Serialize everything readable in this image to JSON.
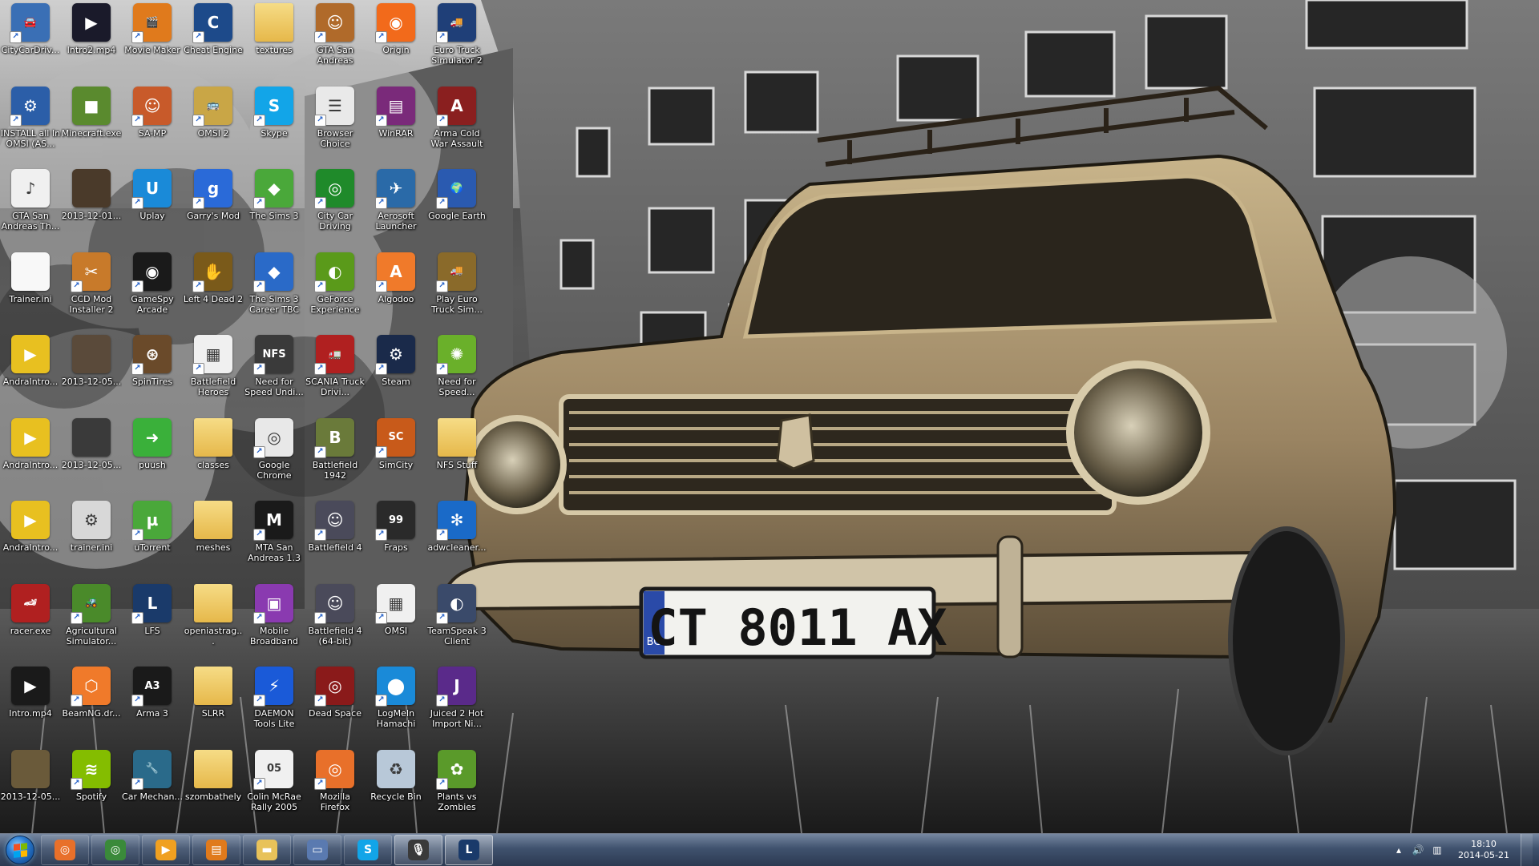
{
  "screen": {
    "name": "Windows 7 desktop"
  },
  "wallpaper": {
    "plate_country": "BG",
    "plate_text": "CT 8011 AX"
  },
  "desktop_icons": [
    {
      "label": "CityCarDriv...",
      "icon": "city-car-driving-icon",
      "color": "#3a6fb5",
      "glyph": "🚘",
      "shortcut": true
    },
    {
      "label": "Intro2.mp4",
      "icon": "video-file-icon",
      "color": "#1a1a2a",
      "glyph": "▶",
      "shortcut": false
    },
    {
      "label": "Movie Maker",
      "icon": "movie-maker-icon",
      "color": "#e07a1c",
      "glyph": "🎬",
      "shortcut": true
    },
    {
      "label": "Cheat Engine",
      "icon": "cheat-engine-icon",
      "color": "#1d4a8a",
      "glyph": "C",
      "shortcut": true
    },
    {
      "label": "textures",
      "icon": "folder-icon",
      "color": "#e8c25a",
      "glyph": "",
      "shortcut": false,
      "folder": true
    },
    {
      "label": "GTA San Andreas",
      "icon": "gta-san-andreas-icon",
      "color": "#b06a2a",
      "glyph": "☺",
      "shortcut": true
    },
    {
      "label": "Origin",
      "icon": "origin-icon",
      "color": "#f26a1b",
      "glyph": "◉",
      "shortcut": true
    },
    {
      "label": "Euro Truck Simulator 2",
      "icon": "euro-truck-simulator-icon",
      "color": "#1f3f78",
      "glyph": "🚚",
      "shortcut": true
    },
    {
      "label": "INSTALL all In OMSI (AS...",
      "icon": "installer-icon",
      "color": "#2b5ea8",
      "glyph": "⚙",
      "shortcut": true
    },
    {
      "label": "Minecraft.exe",
      "icon": "minecraft-icon",
      "color": "#5a8a2e",
      "glyph": "■",
      "shortcut": false
    },
    {
      "label": "SA-MP",
      "icon": "sa-mp-icon",
      "color": "#c85a2a",
      "glyph": "☺",
      "shortcut": true
    },
    {
      "label": "OMSI 2",
      "icon": "omsi-2-icon",
      "color": "#c9a646",
      "glyph": "🚌",
      "shortcut": true
    },
    {
      "label": "Skype",
      "icon": "skype-icon",
      "color": "#12a5e8",
      "glyph": "S",
      "shortcut": true
    },
    {
      "label": "Browser Choice",
      "icon": "browser-choice-icon",
      "color": "#e9e9e9",
      "glyph": "☰",
      "shortcut": true
    },
    {
      "label": "WinRAR",
      "icon": "winrar-icon",
      "color": "#7a2a7a",
      "glyph": "▤",
      "shortcut": true
    },
    {
      "label": "Arma Cold War Assault",
      "icon": "arma-cold-war-icon",
      "color": "#8a1f1f",
      "glyph": "A",
      "shortcut": true
    },
    {
      "label": "GTA San Andreas Th...",
      "icon": "mp3-file-icon",
      "color": "#f0f0f0",
      "glyph": "♪",
      "shortcut": false
    },
    {
      "label": "2013-12-01...",
      "icon": "video-thumbnail-icon",
      "color": "#4a3a2a",
      "glyph": "",
      "shortcut": false
    },
    {
      "label": "Uplay",
      "icon": "uplay-icon",
      "color": "#1a8ad8",
      "glyph": "U",
      "shortcut": true
    },
    {
      "label": "Garry's Mod",
      "icon": "garrys-mod-icon",
      "color": "#2a6ad8",
      "glyph": "g",
      "shortcut": true
    },
    {
      "label": "The Sims 3",
      "icon": "the-sims-icon",
      "color": "#4aa83a",
      "glyph": "◆",
      "shortcut": true
    },
    {
      "label": "City Car Driving",
      "icon": "city-car-driving-2-icon",
      "color": "#1f8a2a",
      "glyph": "◎",
      "shortcut": true
    },
    {
      "label": "Aerosoft Launcher",
      "icon": "aerosoft-icon",
      "color": "#2a6aa8",
      "glyph": "✈",
      "shortcut": true
    },
    {
      "label": "Google Earth",
      "icon": "google-earth-icon",
      "color": "#2a5ab0",
      "glyph": "🌍",
      "shortcut": true
    },
    {
      "label": "Trainer.ini",
      "icon": "text-file-icon",
      "color": "#f8f8f8",
      "glyph": "",
      "shortcut": false
    },
    {
      "label": "CCD Mod Installer 2",
      "icon": "ccd-mod-installer-icon",
      "color": "#c87a2a",
      "glyph": "✂",
      "shortcut": true
    },
    {
      "label": "GameSpy Arcade",
      "icon": "gamespy-icon",
      "color": "#1a1a1a",
      "glyph": "◉",
      "shortcut": true
    },
    {
      "label": "Left 4 Dead 2",
      "icon": "left-4-dead-2-icon",
      "color": "#7a5a1a",
      "glyph": "✋",
      "shortcut": true
    },
    {
      "label": "The Sims 3 Career TBC",
      "icon": "the-sims-career-icon",
      "color": "#2a6ac8",
      "glyph": "◆",
      "shortcut": true
    },
    {
      "label": "GeForce Experience",
      "icon": "geforce-icon",
      "color": "#5a9a1a",
      "glyph": "◐",
      "shortcut": true
    },
    {
      "label": "Algodoo",
      "icon": "algodoo-icon",
      "color": "#f07a2a",
      "glyph": "A",
      "shortcut": true
    },
    {
      "label": "Play Euro Truck Sim...",
      "icon": "play-euro-truck-icon",
      "color": "#8a6a2a",
      "glyph": "🚚",
      "shortcut": true
    },
    {
      "label": "AndraIntro...",
      "icon": "video-file-yellow-icon",
      "color": "#e8c020",
      "glyph": "▶",
      "shortcut": false
    },
    {
      "label": "2013-12-05...",
      "icon": "video-thumbnail-2-icon",
      "color": "#5a4a3a",
      "glyph": "",
      "shortcut": false
    },
    {
      "label": "SpinTires",
      "icon": "spintires-icon",
      "color": "#6a4a2a",
      "glyph": "⊛",
      "shortcut": true
    },
    {
      "label": "Battlefield Heroes",
      "icon": "calendar-icon",
      "color": "#f0f0f0",
      "glyph": "▦",
      "shortcut": true
    },
    {
      "label": "Need for Speed Undi...",
      "icon": "need-for-speed-icon",
      "color": "#3a3a3a",
      "glyph": "NFS",
      "shortcut": true
    },
    {
      "label": "SCANIA Truck Drivi...",
      "icon": "scania-icon",
      "color": "#b02020",
      "glyph": "🚛",
      "shortcut": true
    },
    {
      "label": "Steam",
      "icon": "steam-icon",
      "color": "#1a2a4a",
      "glyph": "⚙",
      "shortcut": true
    },
    {
      "label": "Need for Speed...",
      "icon": "need-for-speed-2-icon",
      "color": "#6ab02a",
      "glyph": "✺",
      "shortcut": true
    },
    {
      "label": "AndraIntro...",
      "icon": "video-file-yellow-2-icon",
      "color": "#e8c020",
      "glyph": "▶",
      "shortcut": false
    },
    {
      "label": "2013-12-05...",
      "icon": "video-thumbnail-3-icon",
      "color": "#3a3a3a",
      "glyph": "",
      "shortcut": false
    },
    {
      "label": "puush",
      "icon": "puush-icon",
      "color": "#3ab03a",
      "glyph": "➜",
      "shortcut": false
    },
    {
      "label": "classes",
      "icon": "folder-icon",
      "color": "#e8c25a",
      "glyph": "",
      "shortcut": false,
      "folder": true
    },
    {
      "label": "Google Chrome",
      "icon": "chrome-icon",
      "color": "#e8e8e8",
      "glyph": "◎",
      "shortcut": true
    },
    {
      "label": "Battlefield 1942",
      "icon": "battlefield-1942-icon",
      "color": "#6a7a3a",
      "glyph": "B",
      "shortcut": true
    },
    {
      "label": "SimCity",
      "icon": "simcity-icon",
      "color": "#c85a1a",
      "glyph": "SC",
      "shortcut": true
    },
    {
      "label": "NFS Stuff",
      "icon": "folder-icon",
      "color": "#e8c25a",
      "glyph": "",
      "shortcut": false,
      "folder": true
    },
    {
      "label": "AndraIntro...",
      "icon": "video-file-yellow-3-icon",
      "color": "#e8c020",
      "glyph": "▶",
      "shortcut": false
    },
    {
      "label": "trainer.ini",
      "icon": "settings-file-icon",
      "color": "#d8d8d8",
      "glyph": "⚙",
      "shortcut": false
    },
    {
      "label": "uTorrent",
      "icon": "utorrent-icon",
      "color": "#4aa83a",
      "glyph": "µ",
      "shortcut": true
    },
    {
      "label": "meshes",
      "icon": "folder-icon",
      "color": "#e8c25a",
      "glyph": "",
      "shortcut": false,
      "folder": true
    },
    {
      "label": "MTA San Andreas 1.3",
      "icon": "mta-san-andreas-icon",
      "color": "#1a1a1a",
      "glyph": "M",
      "shortcut": true
    },
    {
      "label": "Battlefield 4",
      "icon": "battlefield-4-icon",
      "color": "#4a4a5a",
      "glyph": "☺",
      "shortcut": true
    },
    {
      "label": "Fraps",
      "icon": "fraps-icon",
      "color": "#2a2a2a",
      "glyph": "99",
      "shortcut": true
    },
    {
      "label": "adwcleaner...",
      "icon": "adwcleaner-icon",
      "color": "#1a6ac8",
      "glyph": "✻",
      "shortcut": true
    },
    {
      "label": "racer.exe",
      "icon": "racer-exe-icon",
      "color": "#b02020",
      "glyph": "🏎",
      "shortcut": false
    },
    {
      "label": "Agricultural Simulator...",
      "icon": "agricultural-simulator-icon",
      "color": "#4a8a2a",
      "glyph": "🚜",
      "shortcut": true
    },
    {
      "label": "LFS",
      "icon": "lfs-icon",
      "color": "#1a3a6a",
      "glyph": "L",
      "shortcut": true
    },
    {
      "label": "openiastrag...",
      "icon": "folder-icon",
      "color": "#e8c25a",
      "glyph": "",
      "shortcut": false,
      "folder": true
    },
    {
      "label": "Mobile Broadband",
      "icon": "mobile-broadband-icon",
      "color": "#8a3ab0",
      "glyph": "▣",
      "shortcut": true
    },
    {
      "label": "Battlefield 4 (64-bit)",
      "icon": "battlefield-4-64-icon",
      "color": "#4a4a5a",
      "glyph": "☺",
      "shortcut": true
    },
    {
      "label": "OMSI",
      "icon": "omsi-icon",
      "color": "#f0f0f0",
      "glyph": "▦",
      "shortcut": true
    },
    {
      "label": "TeamSpeak 3 Client",
      "icon": "teamspeak-icon",
      "color": "#3a4a6a",
      "glyph": "◐",
      "shortcut": true
    },
    {
      "label": "Intro.mp4",
      "icon": "video-file-2-icon",
      "color": "#1a1a1a",
      "glyph": "▶",
      "shortcut": false
    },
    {
      "label": "BeamNG.dr...",
      "icon": "beamng-icon",
      "color": "#f07a2a",
      "glyph": "⬡",
      "shortcut": true
    },
    {
      "label": "Arma 3",
      "icon": "arma-3-icon",
      "color": "#1a1a1a",
      "glyph": "A3",
      "shortcut": true
    },
    {
      "label": "SLRR",
      "icon": "folder-icon",
      "color": "#e8c25a",
      "glyph": "",
      "shortcut": false,
      "folder": true
    },
    {
      "label": "DAEMON Tools Lite",
      "icon": "daemon-tools-icon",
      "color": "#1a5ad8",
      "glyph": "⚡",
      "shortcut": true
    },
    {
      "label": "Dead Space",
      "icon": "dead-space-icon",
      "color": "#8a1a1a",
      "glyph": "◎",
      "shortcut": true
    },
    {
      "label": "LogMeIn Hamachi",
      "icon": "hamachi-icon",
      "color": "#1a8ad8",
      "glyph": "⬤",
      "shortcut": true
    },
    {
      "label": "Juiced 2 Hot Import Ni...",
      "icon": "juiced-2-icon",
      "color": "#5a2a8a",
      "glyph": "J",
      "shortcut": true
    },
    {
      "label": "2013-12-05...",
      "icon": "video-thumbnail-4-icon",
      "color": "#6a5a3a",
      "glyph": "",
      "shortcut": false
    },
    {
      "label": "Spotify",
      "icon": "spotify-icon",
      "color": "#84bd00",
      "glyph": "≋",
      "shortcut": true
    },
    {
      "label": "Car Mechan...",
      "icon": "car-mechanic-icon",
      "color": "#2a6a8a",
      "glyph": "🔧",
      "shortcut": true
    },
    {
      "label": "szombathely",
      "icon": "folder-icon",
      "color": "#e8c25a",
      "glyph": "",
      "shortcut": false,
      "folder": true
    },
    {
      "label": "Colin McRae Rally 2005",
      "icon": "colin-mcrae-icon",
      "color": "#f0f0f0",
      "glyph": "05",
      "shortcut": true
    },
    {
      "label": "Mozilla Firefox",
      "icon": "firefox-icon",
      "color": "#e8702a",
      "glyph": "◎",
      "shortcut": true
    },
    {
      "label": "Recycle Bin",
      "icon": "recycle-bin-icon",
      "color": "#b8c8d8",
      "glyph": "♻",
      "shortcut": false
    },
    {
      "label": "Plants vs Zombies",
      "icon": "plants-vs-zombies-icon",
      "color": "#5a9a2a",
      "glyph": "✿",
      "shortcut": true
    }
  ],
  "taskbar": {
    "start_label": "Start",
    "buttons": [
      {
        "name": "firefox",
        "icon": "firefox-icon",
        "color": "#e8702a",
        "glyph": "◎",
        "active": false
      },
      {
        "name": "chrome",
        "icon": "chrome-icon",
        "color": "#3a8a3a",
        "glyph": "◎",
        "active": false
      },
      {
        "name": "media-player",
        "icon": "media-player-icon",
        "color": "#f0a020",
        "glyph": "▶",
        "active": false
      },
      {
        "name": "movie-maker",
        "icon": "movie-maker-icon",
        "color": "#e07a1c",
        "glyph": "▤",
        "active": false
      },
      {
        "name": "explorer",
        "icon": "folder-icon",
        "color": "#e8c25a",
        "glyph": "▬",
        "active": false
      },
      {
        "name": "network",
        "icon": "network-icon",
        "color": "#5a7ab0",
        "glyph": "▭",
        "active": false
      },
      {
        "name": "skype",
        "icon": "skype-icon",
        "color": "#12a5e8",
        "glyph": "S",
        "active": false
      },
      {
        "name": "sound-recorder",
        "icon": "microphone-icon",
        "color": "#3a3a3a",
        "glyph": "🎙",
        "active": true
      },
      {
        "name": "lfs",
        "icon": "lfs-icon",
        "color": "#1a3a6a",
        "glyph": "L",
        "active": true
      }
    ]
  },
  "tray": {
    "time": "18:10",
    "date": "2014-05-21"
  }
}
